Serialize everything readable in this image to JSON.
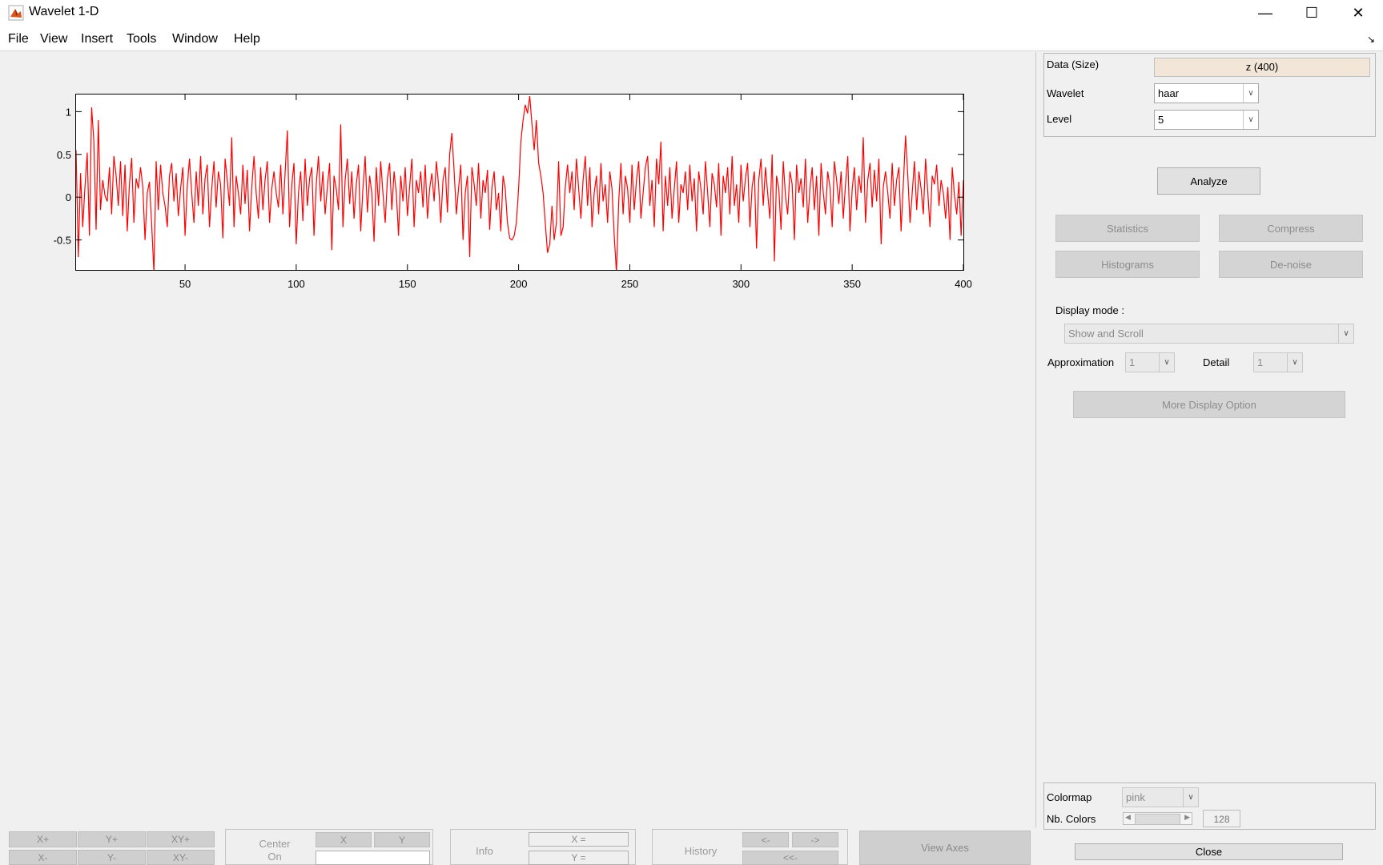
{
  "window": {
    "title": "Wavelet 1-D"
  },
  "menu": [
    "File",
    "View",
    "Insert",
    "Tools",
    "Window",
    "Help"
  ],
  "chart_data": {
    "type": "line",
    "title": "",
    "xlabel": "",
    "ylabel": "",
    "xlim": [
      1,
      400
    ],
    "ylim": [
      -0.85,
      1.2
    ],
    "xticks": [
      50,
      100,
      150,
      200,
      250,
      300,
      350,
      400
    ],
    "yticks": [
      1,
      0.5,
      0,
      -0.5
    ],
    "color": "#ff0000",
    "series": [
      {
        "values": [
          0.55,
          -0.7,
          0.28,
          -0.35,
          0.12,
          0.52,
          -0.45,
          1.05,
          0.65,
          -0.38,
          0.9,
          -0.15,
          0.2,
          0.02,
          -0.05,
          0.35,
          -0.2,
          0.48,
          0.25,
          -0.1,
          0.42,
          -0.22,
          0.38,
          -0.4,
          0.15,
          0.46,
          -0.3,
          0.22,
          0.1,
          0.35,
          0.12,
          -0.5,
          0.05,
          0.18,
          -0.32,
          -0.88,
          0.42,
          -0.15,
          0.38,
          0.05,
          -0.1,
          -0.35,
          0.25,
          0.4,
          -0.05,
          0.28,
          -0.22,
          0.1,
          0.35,
          -0.45,
          0.12,
          0.45,
          0.05,
          -0.3,
          0.3,
          -0.1,
          0.48,
          -0.2,
          0.22,
          0.38,
          -0.35,
          0.1,
          0.42,
          -0.12,
          0.3,
          0.15,
          -0.48,
          0.45,
          0.2,
          -0.1,
          0.7,
          -0.35,
          0.25,
          0.05,
          -0.2,
          0.38,
          -0.08,
          0.32,
          -0.4,
          0.12,
          0.48,
          0.05,
          -0.25,
          0.35,
          -0.15,
          0.2,
          0.42,
          -0.3,
          0.1,
          0.3,
          0.05,
          -0.12,
          0.38,
          -0.2,
          0.28,
          0.78,
          -0.35,
          0.15,
          0.4,
          -0.55,
          0.05,
          0.3,
          -0.28,
          0.45,
          -0.1,
          0.22,
          0.35,
          -0.45,
          0.15,
          0.48,
          -0.05,
          0.3,
          -0.2,
          0.12,
          0.4,
          -0.62,
          0.25,
          0.1,
          -0.15,
          0.85,
          -0.35,
          0.2,
          0.45,
          -0.08,
          0.3,
          -0.25,
          0.15,
          0.38,
          -0.4,
          0.1,
          0.48,
          -0.18,
          0.25,
          0.05,
          -0.52,
          0.35,
          -0.1,
          0.42,
          0.05,
          -0.3,
          0.22,
          0.4,
          -0.15,
          0.3,
          0.05,
          -0.45,
          0.25,
          -0.05,
          0.35,
          -0.22,
          0.12,
          0.45,
          -0.35,
          0.2,
          0.05,
          0.3,
          -0.12,
          0.38,
          -0.25,
          0.1,
          0.28,
          -0.05,
          0.42,
          0.15,
          -0.3,
          0.2,
          0.35,
          -0.18,
          0.5,
          0.75,
          0.3,
          -0.2,
          0.1,
          0.38,
          -0.5,
          0.05,
          0.25,
          -0.7,
          0.35,
          0.15,
          -0.1,
          0.4,
          -0.25,
          0.2,
          0.05,
          0.32,
          -0.38,
          0.12,
          0.3,
          -0.15,
          0.05,
          -0.4,
          0.25,
          0.1,
          -0.3,
          -0.48,
          -0.5,
          -0.45,
          -0.3,
          0.1,
          0.65,
          0.9,
          1.08,
          0.98,
          1.18,
          0.85,
          0.55,
          0.9,
          0.4,
          0.25,
          0.05,
          -0.3,
          -0.65,
          -0.55,
          -0.1,
          -0.5,
          -0.3,
          0.42,
          -0.45,
          -0.35,
          0.12,
          0.38,
          0.05,
          0.3,
          -0.15,
          0.45,
          0.1,
          -0.25,
          0.2,
          0.48,
          -0.1,
          0.35,
          -0.35,
          0.05,
          0.25,
          -0.2,
          0.4,
          -0.05,
          0.15,
          -0.3,
          0.3,
          0.1,
          -0.45,
          -0.88,
          -0.05,
          0.4,
          -0.2,
          0.25,
          0.1,
          -0.3,
          0.38,
          -0.15,
          0.2,
          0.42,
          -0.25,
          0.05,
          0.35,
          0.48,
          -0.1,
          0.2,
          -0.35,
          0.45,
          0.15,
          0.65,
          -0.4,
          0.25,
          -0.1,
          0.35,
          -0.25,
          0.1,
          0.42,
          -0.3,
          0.15,
          0.05,
          0.3,
          -0.15,
          0.38,
          -0.05,
          0.22,
          -0.4,
          0.3,
          0.1,
          -0.2,
          0.42,
          0.05,
          -0.35,
          0.28,
          0.15,
          -0.12,
          0.4,
          -0.45,
          0.25,
          0.05,
          0.35,
          -0.2,
          0.48,
          -0.1,
          0.15,
          -0.3,
          0.38,
          -0.05,
          0.22,
          0.4,
          -0.35,
          0.12,
          0.3,
          -0.6,
          0.2,
          0.45,
          -0.1,
          0.35,
          0.05,
          -0.25,
          0.5,
          -0.75,
          0.25,
          0.1,
          -0.38,
          0.42,
          0.02,
          -0.2,
          0.3,
          0.15,
          -0.5,
          0.38,
          0.05,
          0.22,
          -0.12,
          0.45,
          -0.3,
          0.1,
          0.35,
          -0.15,
          0.25,
          -0.45,
          0.4,
          0.05,
          -0.2,
          0.3,
          0.12,
          -0.35,
          0.42,
          0.2,
          -0.08,
          0.3,
          -0.25,
          0.15,
          0.48,
          -0.4,
          0.1,
          0.35,
          -0.15,
          0.25,
          0.05,
          0.7,
          -0.3,
          0.2,
          0.4,
          -0.12,
          0.32,
          -0.05,
          0.45,
          -0.55,
          0.12,
          0.3,
          0.05,
          -0.25,
          0.4,
          -0.1,
          0.2,
          0.35,
          -0.4,
          0.15,
          0.72,
          0.25,
          -0.3,
          0.05,
          0.42,
          -0.15,
          0.3,
          0.1,
          -0.2,
          0.45,
          0.05,
          -0.35,
          0.25,
          0.15,
          0.38,
          -0.1,
          0.2,
          0.05,
          -0.25,
          0.12,
          -0.5,
          0.35,
          0.02,
          -0.2,
          0.18,
          -0.45,
          0.2
        ]
      }
    ]
  },
  "panel": {
    "data_label": "Data  (Size)",
    "data_value": "z  (400)",
    "wavelet_label": "Wavelet",
    "wavelet_value": "haar",
    "level_label": "Level",
    "level_value": "5",
    "analyze": "Analyze",
    "statistics": "Statistics",
    "compress": "Compress",
    "histograms": "Histograms",
    "denoise": "De-noise",
    "display_mode_label": "Display mode :",
    "display_mode_value": "Show and Scroll",
    "approx_label": "Approximation",
    "approx_value": "1",
    "detail_label": "Detail",
    "detail_value": "1",
    "more_display": "More Display Option",
    "colormap_label": "Colormap",
    "colormap_value": "pink",
    "nbcolors_label": "Nb. Colors",
    "nbcolors_value": "128",
    "close": "Close"
  },
  "bottom": {
    "xplus": "X+",
    "yplus": "Y+",
    "xyplus": "XY+",
    "xminus": "X-",
    "yminus": "Y-",
    "xyminus": "XY-",
    "center_on": "Center",
    "center_on2": "On",
    "center_x": "X",
    "center_y": "Y",
    "info": "Info",
    "info_x": "X =",
    "info_y": "Y =",
    "history": "History",
    "hist_back": "<-",
    "hist_fwd": "->",
    "hist_first": "<<-",
    "view_axes": "View Axes"
  }
}
